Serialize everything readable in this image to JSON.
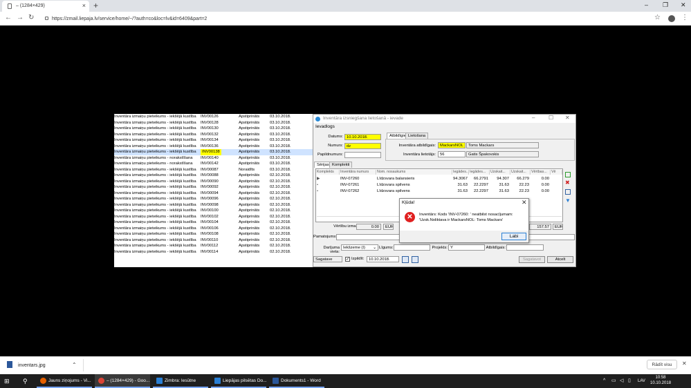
{
  "browser": {
    "tab_title": "– (1284×429)",
    "url": "https://zmail.liepaja.lv/service/home/~/?auth=co&loc=lv&id=6409&part=2"
  },
  "list_rows": [
    [
      "Inventāra izmaiņu pieteikums - iekšējā kustība",
      "INV00126",
      "Apstiprināts",
      "03.10.2018."
    ],
    [
      "Inventāra izmaiņu pieteikums - iekšējā kustība",
      "INV00128",
      "Apstiprināts",
      "03.10.2018."
    ],
    [
      "Inventāra izmaiņu pieteikums - iekšējā kustība",
      "INV00130",
      "Apstiprināts",
      "03.10.2018."
    ],
    [
      "Inventāra izmaiņu pieteikums - iekšējā kustība",
      "INV00132",
      "Apstiprināts",
      "03.10.2018."
    ],
    [
      "Inventāra izmaiņu pieteikums - iekšējā kustība",
      "INV00134",
      "Apstiprināts",
      "03.10.2018."
    ],
    [
      "Inventāra izmaiņu pieteikums - iekšējā kustība",
      "INV00136",
      "Apstiprināts",
      "03.10.2018."
    ],
    [
      "Inventāra izmaiņu pieteikums - iekšējā kustība",
      "INV00138",
      "Apstiprināts",
      "03.10.2018."
    ],
    [
      "Inventāra izmaiņu pieteikums - norakstīšana",
      "INV00140",
      "Apstiprināts",
      "03.10.2018."
    ],
    [
      "Inventāra izmaiņu pieteikums - norakstīšana",
      "INV00142",
      "Apstiprināts",
      "03.10.2018."
    ],
    [
      "Inventāra izmaiņu pieteikums - iekšējā kustība",
      "INV00087",
      "Noraidīts",
      "03.10.2018."
    ],
    [
      "Inventāra izmaiņu pieteikums - iekšējā kustība",
      "INV00088",
      "Apstiprināts",
      "02.10.2018."
    ],
    [
      "Inventāra izmaiņu pieteikums - iekšējā kustība",
      "INV00090",
      "Apstiprināts",
      "02.10.2018."
    ],
    [
      "Inventāra izmaiņu pieteikums - iekšējā kustība",
      "INV00092",
      "Apstiprināts",
      "02.10.2018."
    ],
    [
      "Inventāra izmaiņu pieteikums - iekšējā kustība",
      "INV00094",
      "Apstiprināts",
      "02.10.2018."
    ],
    [
      "Inventāra izmaiņu pieteikums - iekšējā kustība",
      "INV00096",
      "Apstiprināts",
      "02.10.2018."
    ],
    [
      "Inventāra izmaiņu pieteikums - iekšējā kustība",
      "INV00098",
      "Apstiprināts",
      "02.10.2018."
    ],
    [
      "Inventāra izmaiņu pieteikums - iekšējā kustība",
      "INV00100",
      "Apstiprināts",
      "02.10.2018."
    ],
    [
      "Inventāra izmaiņu pieteikums - iekšējā kustība",
      "INV00102",
      "Apstiprināts",
      "02.10.2018."
    ],
    [
      "Inventāra izmaiņu pieteikums - iekšējā kustība",
      "INV00104",
      "Apstiprināts",
      "02.10.2018."
    ],
    [
      "Inventāra izmaiņu pieteikums - iekšējā kustība",
      "INV00106",
      "Apstiprināts",
      "02.10.2018."
    ],
    [
      "Inventāra izmaiņu pieteikums - iekšējā kustība",
      "INV00108",
      "Apstiprināts",
      "02.10.2018."
    ],
    [
      "Inventāra izmaiņu pieteikums - iekšējā kustība",
      "INV00110",
      "Apstiprināts",
      "02.10.2018."
    ],
    [
      "Inventāra izmaiņu pieteikums - iekšējā kustība",
      "INV00112",
      "Apstiprināts",
      "02.10.2018."
    ],
    [
      "Inventāra izmaiņu pieteikums - iekšējā kustība",
      "INV00114",
      "Apstiprināts",
      "02.10.2018."
    ]
  ],
  "highlight_row": 6,
  "dialog": {
    "title": "Inventāra izsniegšana lietošanā - ievade",
    "group": "Ievadlogs",
    "datums_label": "Datums:",
    "datums": "10.10.2018.",
    "numurs_label": "Numurs:",
    "numurs": "dz",
    "papild_label": "Papildnumurs:",
    "papild": "",
    "tab_atbildigie": "Atbildīgie",
    "tab_lietosana": "Lietošana",
    "atbildigais_label": "Inventāra atbildīgais:",
    "atbildigais_code": "MackarsNOL",
    "atbildigais_name": "Toms Mackars",
    "lietotajs_label": "Inventāra lietotājs:",
    "lietotajs_code": "56",
    "lietotajs_name": "Gatis Špakovskis",
    "tab_serijas": "Sērijas",
    "tab_komplekti": "Komplekti",
    "grid_headers": [
      "Komplekts",
      "Inventāra numurs",
      "Nom. nosaukums",
      "Iegādes...",
      "Iegādes...",
      "Uzskait...",
      "Uzskait...",
      "Vērtbas...",
      "Vē"
    ],
    "grid_rows": [
      [
        "INV-07260",
        "Līdzsvara balansieris",
        "94.3067",
        "66.2791",
        "94.307",
        "66.279",
        "0.00"
      ],
      [
        "INV-07261",
        "Līdzsvara spilvens",
        "31.63",
        "22.2297",
        "31.63",
        "22.23",
        "0.00"
      ],
      [
        "INV-07262",
        "Līdzsvara spilvens",
        "31.63",
        "22.2297",
        "31.63",
        "22.23",
        "0.00"
      ]
    ],
    "vertibu_label": "Vērtību izmaiņa:",
    "vertibu_value": "0.00",
    "eur": "EUR",
    "total": "157.57",
    "eur2": "EUR",
    "pamatojums_label": "Pamatojums:",
    "darijuma_label": "Darījuma vieta:",
    "darijuma_value": "Iekšzeme (I)",
    "ligums_label": "Līgums:",
    "projekts_label": "Projekts:",
    "projekts_value": "Y",
    "atbildigais2_label": "Atbildīgais:",
    "status_value": "Sagatave",
    "izpildit_label": "Izpildīt:",
    "izpildit_date": "10.10.2018.",
    "sagatavot_btn": "Sagatavot",
    "atcelt_btn": "Atcelt"
  },
  "error": {
    "title": "Kļūda!",
    "message": "Inventārs: Kods 'INV-07260: ' neatbilst nosacījumam: 'Uzsk.Noliktava ir MackarsNOL: Toms Mackars'",
    "ok": "Labi"
  },
  "download": {
    "file": "inventars.jpg",
    "show_all": "Rādīt visu"
  },
  "taskbar": {
    "items": [
      "Jauns ziņojums - Vi...",
      "– (1284×429) - Goo...",
      "Zimbra: Iesūtne",
      "Liepājas pilsētas Do...",
      "Dokuments1 - Word"
    ],
    "lang": "LAV",
    "time": "10:58",
    "date": "10.10.2018"
  }
}
